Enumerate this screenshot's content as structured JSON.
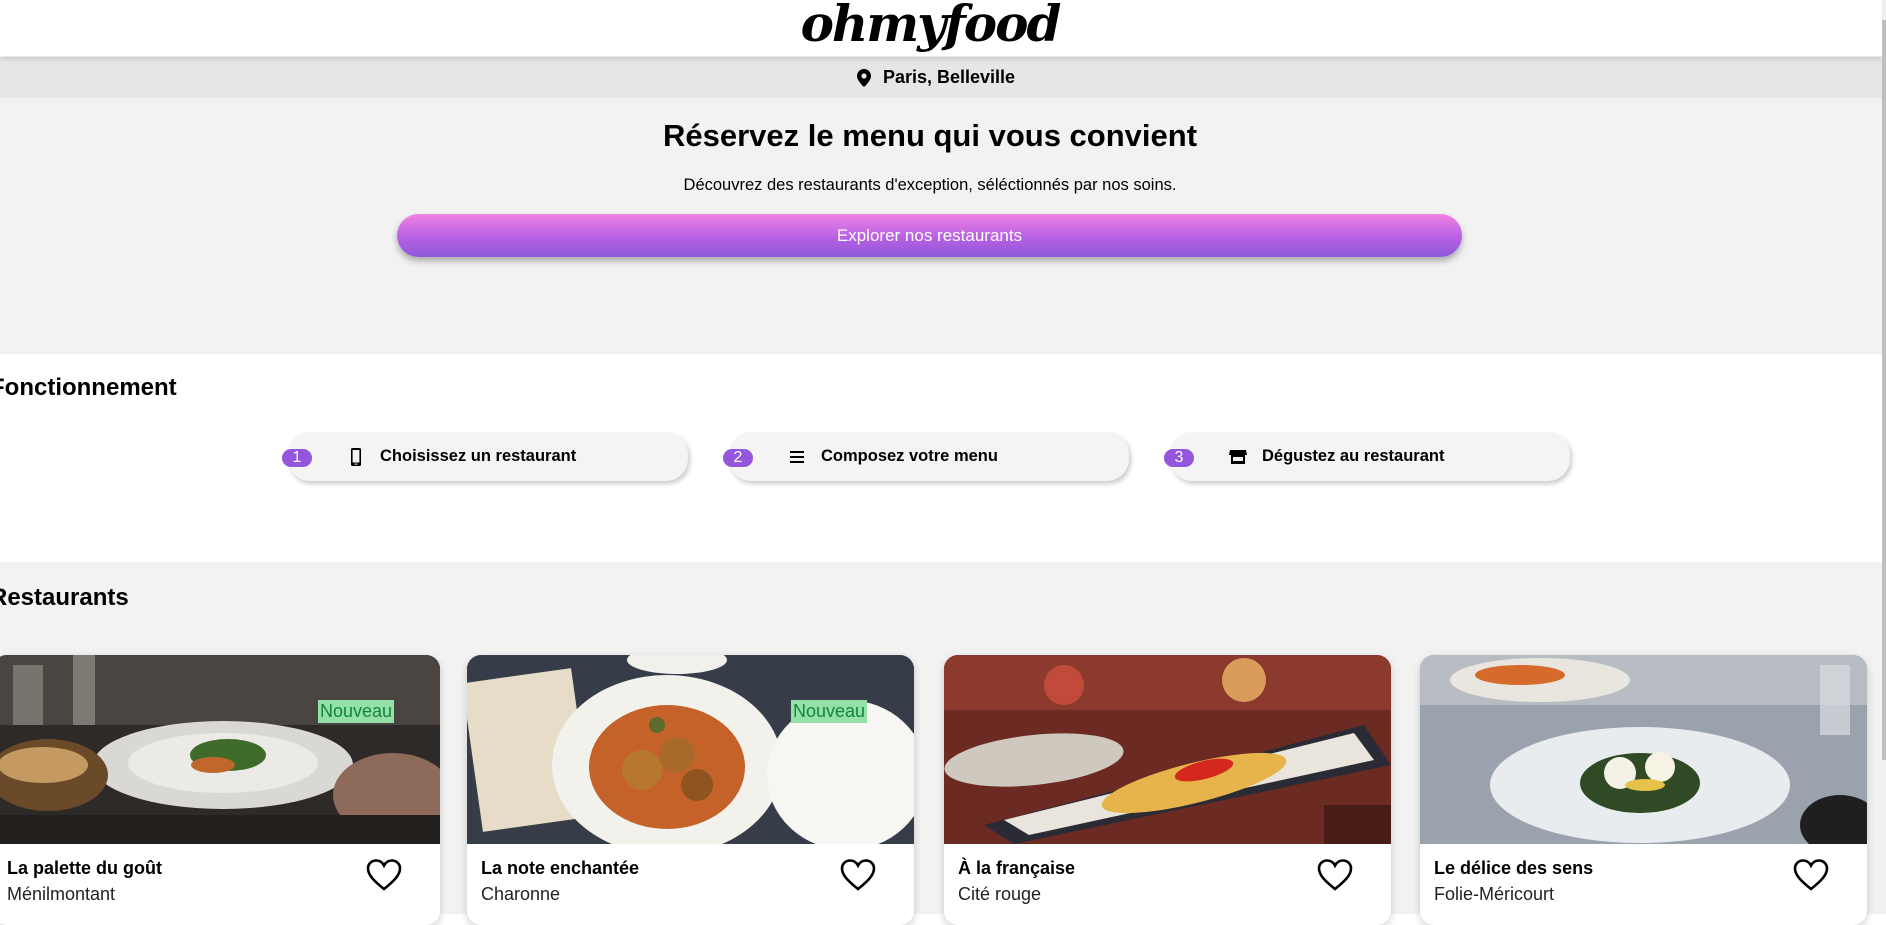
{
  "brand": {
    "logo": "ohmyfood"
  },
  "location": {
    "label": "Paris, Belleville",
    "icon": "map-pin-icon"
  },
  "hero": {
    "title": "Réservez le menu qui vous convient",
    "subtitle": "Découvrez des restaurants d'exception, séléctionnés par nos soins.",
    "cta_label": "Explorer nos restaurants"
  },
  "how": {
    "title": "Fonctionnement",
    "steps": [
      {
        "number": "1",
        "label": "Choisissez un restaurant",
        "icon": "smartphone-icon"
      },
      {
        "number": "2",
        "label": "Composez votre menu",
        "icon": "list-icon"
      },
      {
        "number": "3",
        "label": "Dégustez au restaurant",
        "icon": "store-icon"
      }
    ]
  },
  "restaurants": {
    "title": "Restaurants",
    "items": [
      {
        "name": "La palette du goût",
        "area": "Ménilmontant",
        "badge": "Nouveau",
        "favorite_icon": "heart-icon"
      },
      {
        "name": "La note enchantée",
        "area": "Charonne",
        "badge": "Nouveau",
        "favorite_icon": "heart-icon"
      },
      {
        "name": "À la française",
        "area": "Cité rouge",
        "badge": "",
        "favorite_icon": "heart-icon"
      },
      {
        "name": "Le délice des sens",
        "area": "Folie-Méricourt",
        "badge": "",
        "favorite_icon": "heart-icon"
      }
    ]
  },
  "colors": {
    "accent": "#9356dc",
    "cta_top": "#f183e3",
    "cta_bottom": "#8f58d8",
    "badge_bg": "#93e0a8",
    "badge_text": "#16843a"
  }
}
